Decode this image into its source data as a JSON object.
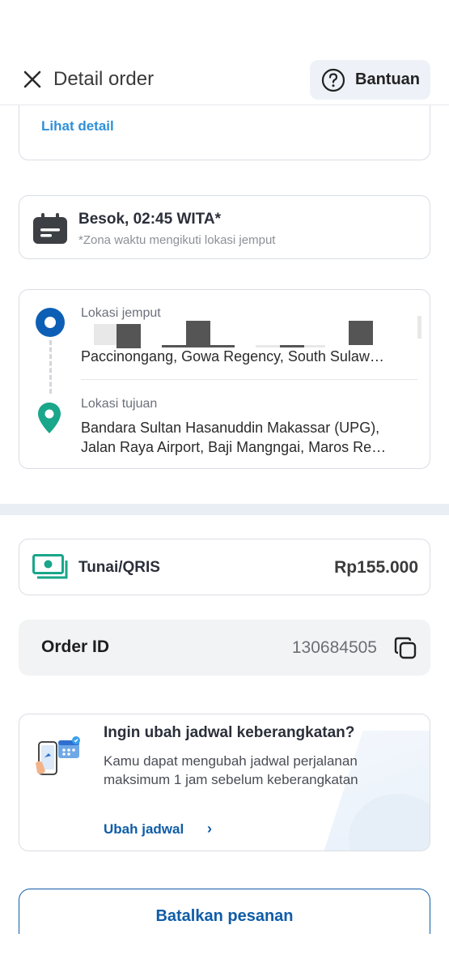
{
  "header": {
    "title": "Detail order",
    "help_label": "Bantuan"
  },
  "top_card": {
    "link_label": "Lihat detail"
  },
  "schedule": {
    "time": "Besok, 02:45 WITA*",
    "note": "*Zona waktu mengikuti lokasi jemput"
  },
  "route": {
    "pickup_label": "Lokasi jemput",
    "pickup_address": "Paccinongang, Gowa Regency, South Sulaw…",
    "dropoff_label": "Lokasi tujuan",
    "dropoff_address_line1": "Bandara Sultan Hasanuddin Makassar (UPG),",
    "dropoff_address_line2": "Jalan Raya Airport, Baji Mangngai, Maros Re…"
  },
  "payment": {
    "method": "Tunai/QRIS",
    "amount": "Rp155.000"
  },
  "order": {
    "label": "Order ID",
    "id": "130684505"
  },
  "reschedule": {
    "title": "Ingin ubah jadwal keberangkatan?",
    "body": "Kamu dapat mengubah jadwal perjalanan maksimum 1 jam sebelum keberangkatan",
    "link_label": "Ubah jadwal",
    "chevron": "›"
  },
  "cancel": {
    "label": "Batalkan pesanan"
  },
  "colors": {
    "primary": "#0f5da8",
    "link": "#2f8fd8",
    "origin_pin": "#0c5fb5",
    "dest_pin": "#1aa68a",
    "cash_icon": "#1aa68a"
  }
}
